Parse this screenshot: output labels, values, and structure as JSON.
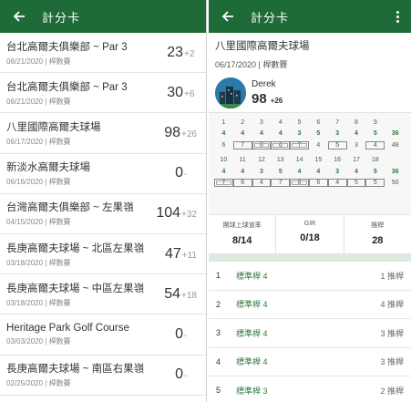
{
  "left": {
    "title": "計分卡",
    "rounds": [
      {
        "course": "台北高爾夫俱樂部 ~ Par 3",
        "meta": "06/21/2020 | 桿數賽",
        "score": "23",
        "diff": "+2"
      },
      {
        "course": "台北高爾夫俱樂部 ~ Par 3",
        "meta": "06/21/2020 | 桿數賽",
        "score": "30",
        "diff": "+6"
      },
      {
        "course": "八里國際高爾夫球場",
        "meta": "06/17/2020 | 桿數賽",
        "score": "98",
        "diff": "+26"
      },
      {
        "course": "新淡水高爾夫球場",
        "meta": "06/16/2020 | 桿數賽",
        "score": "0",
        "diff": "-"
      },
      {
        "course": "台灣高爾夫俱樂部 ~ 左果嶺",
        "meta": "04/15/2020 | 桿數賽",
        "score": "104",
        "diff": "+32"
      },
      {
        "course": "長庚高爾夫球場 ~ 北區左果嶺",
        "meta": "03/18/2020 | 桿數賽",
        "score": "47",
        "diff": "+11"
      },
      {
        "course": "長庚高爾夫球場 ~ 中區左果嶺",
        "meta": "03/18/2020 | 桿數賽",
        "score": "54",
        "diff": "+18"
      },
      {
        "course": "Heritage Park Golf Course",
        "meta": "03/03/2020 | 桿數賽",
        "score": "0",
        "diff": "-"
      },
      {
        "course": "長庚高爾夫球場 ~ 南區右果嶺",
        "meta": "02/25/2020 | 桿數賽",
        "score": "0",
        "diff": "-"
      }
    ]
  },
  "right": {
    "title": "計分卡",
    "course": "八里國際高爾夫球場",
    "meta": "06/17/2020 | 桿數賽",
    "player": {
      "name": "Derek",
      "total": "98",
      "diff": "+26"
    },
    "front": {
      "holes": [
        "1",
        "2",
        "3",
        "4",
        "5",
        "6",
        "7",
        "8",
        "9",
        ""
      ],
      "par": [
        "4",
        "4",
        "4",
        "4",
        "3",
        "5",
        "3",
        "4",
        "5",
        "36"
      ],
      "scores": [
        "6",
        "7",
        "6",
        "6",
        "7",
        "4",
        "5",
        "3",
        "4",
        "48"
      ],
      "kinds": [
        "plain",
        "box",
        "dbox",
        "dbox",
        "dbox",
        "plain",
        "box",
        "plain",
        "box",
        "tot"
      ]
    },
    "back": {
      "holes": [
        "10",
        "11",
        "12",
        "13",
        "14",
        "15",
        "16",
        "17",
        "18",
        ""
      ],
      "par": [
        "4",
        "4",
        "3",
        "5",
        "4",
        "4",
        "3",
        "4",
        "5",
        "36"
      ],
      "scores": [
        "7",
        "6",
        "4",
        "7",
        "6",
        "6",
        "4",
        "5",
        "5",
        "50"
      ],
      "kinds": [
        "dbox",
        "box",
        "box",
        "box",
        "dbox",
        "box",
        "box",
        "box",
        "box",
        "tot"
      ]
    },
    "stats": [
      {
        "label": "開球上球道率",
        "value": "8/14"
      },
      {
        "label": "GIR",
        "value": "0/18"
      },
      {
        "label": "推桿",
        "value": "28"
      }
    ],
    "holes": [
      {
        "num": "1",
        "club": "標準桿 4",
        "strokes": "1 推桿"
      },
      {
        "num": "2",
        "club": "標準桿 4",
        "strokes": "4 推桿"
      },
      {
        "num": "3",
        "club": "標準桿 4",
        "strokes": "3 推桿"
      },
      {
        "num": "4",
        "club": "標準桿 4",
        "strokes": "3 推桿"
      },
      {
        "num": "5",
        "club": "標準桿 3",
        "strokes": "2 推桿"
      }
    ]
  },
  "colors": {
    "appbar": "#1f6b38",
    "accent_green": "#2b7a3d"
  },
  "icons": {
    "back": "arrow-left-icon",
    "more": "more-vert-icon",
    "avatar": "city-night-avatar"
  }
}
